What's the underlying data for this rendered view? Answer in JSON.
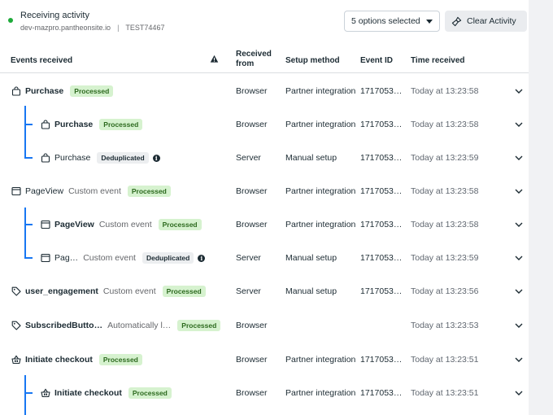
{
  "header": {
    "status": "Receiving activity",
    "domain": "dev-mazpro.pantheonsite.io",
    "separator": "|",
    "test_code": "TEST74467",
    "select_label": "5 options selected",
    "clear_label": "Clear Activity",
    "status_color": "#1eaa3a"
  },
  "columns": {
    "events": "Events received",
    "received_line1": "Received",
    "received_line2": "from",
    "setup": "Setup method",
    "event_id": "Event ID",
    "time": "Time received"
  },
  "rows": [
    {
      "name": "Purchase",
      "custom": "",
      "badge": "Processed",
      "from": "Browser",
      "setup": "Partner integration",
      "event_id": "1717053…",
      "time": "Today at 13:23:58",
      "icon": "bag-icon"
    },
    {
      "name": "Purchase",
      "custom": "",
      "badge": "Processed",
      "from": "Browser",
      "setup": "Partner integration",
      "event_id": "1717053…",
      "time": "Today at 13:23:58",
      "icon": "bag-icon"
    },
    {
      "name": "Purchase",
      "custom": "",
      "badge": "Deduplicated",
      "from": "Server",
      "setup": "Manual setup",
      "event_id": "1717053…",
      "time": "Today at 13:23:59",
      "icon": "bag-icon"
    },
    {
      "name": "PageView",
      "custom": "Custom event",
      "badge": "Processed",
      "from": "Browser",
      "setup": "Partner integration",
      "event_id": "1717053…",
      "time": "Today at 13:23:58",
      "icon": "page-icon"
    },
    {
      "name": "PageView",
      "custom": "Custom event",
      "badge": "Processed",
      "from": "Browser",
      "setup": "Partner integration",
      "event_id": "1717053…",
      "time": "Today at 13:23:58",
      "icon": "page-icon"
    },
    {
      "name": "Pag…",
      "custom": "Custom event",
      "badge": "Deduplicated",
      "from": "Server",
      "setup": "Manual setup",
      "event_id": "1717053…",
      "time": "Today at 13:23:59",
      "icon": "page-icon"
    },
    {
      "name": "user_engagement",
      "custom": "Custom event",
      "badge": "Processed",
      "from": "Server",
      "setup": "Manual setup",
      "event_id": "1717053…",
      "time": "Today at 13:23:56",
      "icon": "tag-icon"
    },
    {
      "name": "SubscribedButto…",
      "custom": "Automatically l…",
      "badge": "Processed",
      "from": "Browser",
      "setup": "",
      "event_id": "",
      "time": "Today at 13:23:53",
      "icon": "tag-icon"
    },
    {
      "name": "Initiate checkout",
      "custom": "",
      "badge": "Processed",
      "from": "Browser",
      "setup": "Partner integration",
      "event_id": "1717053…",
      "time": "Today at 13:23:51",
      "icon": "basket-icon"
    },
    {
      "name": "Initiate checkout",
      "custom": "",
      "badge": "Processed",
      "from": "Browser",
      "setup": "Partner integration",
      "event_id": "1717053…",
      "time": "Today at 13:23:51",
      "icon": "basket-icon"
    }
  ]
}
